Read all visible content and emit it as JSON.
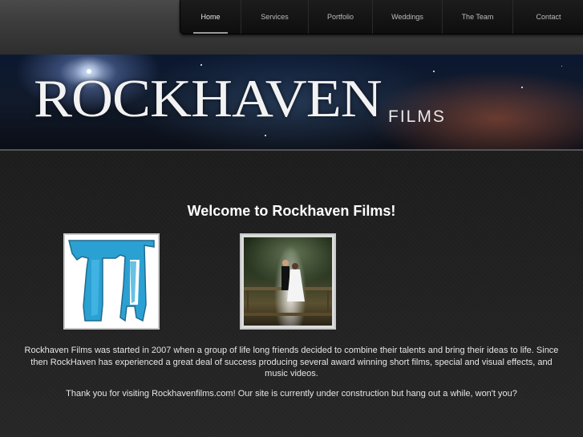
{
  "nav": {
    "items": [
      {
        "label": "Home",
        "active": true
      },
      {
        "label": "Services"
      },
      {
        "label": "Portfolio"
      },
      {
        "label": "Weddings"
      },
      {
        "label": "The Team"
      },
      {
        "label": "Contact"
      }
    ]
  },
  "banner": {
    "brand": "ROCKHAVEN",
    "brand_sub": "FILMS"
  },
  "main": {
    "heading": "Welcome to Rockhaven Films!",
    "paragraph1": "Rockhaven Films was started in 2007 when a group of life long friends decided to combine their talents and bring their ideas to life. Since then RockHaven has experienced a great deal of success producing several award winning short films, special and visual effects, and music videos.",
    "paragraph2": "Thank you for visiting Rockhavenfilms.com! Our site is currently under construction but hang out a while, won't you?"
  },
  "colors": {
    "background": "#1e1e1e",
    "text": "#e6e6e6",
    "logo_blue": "#1a9ad0"
  }
}
